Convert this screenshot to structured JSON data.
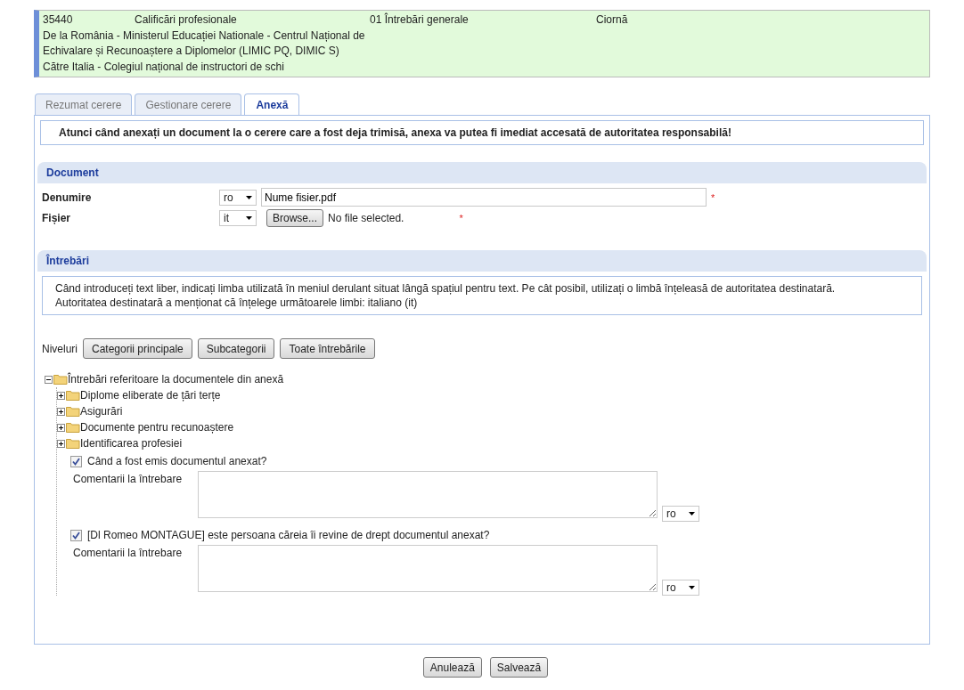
{
  "header": {
    "number": "35440",
    "category": "Calificări profesionale",
    "stage": "01 Întrebări generale",
    "status": "Ciornă",
    "from": "De la România - Ministerul Educației Nationale - Centrul Național de Echivalare și Recunoaștere a Diplomelor (LIMIC PQ, DIMIC S)",
    "to": "Către Italia - Colegiul național de instructori de schi"
  },
  "tabs": [
    {
      "label": "Rezumat cerere",
      "selected": false
    },
    {
      "label": "Gestionare cerere",
      "selected": false
    },
    {
      "label": "Anexă",
      "selected": true
    }
  ],
  "notice": "Atunci când anexați un document la o cerere care a fost deja trimisă, anexa va putea fi imediat accesată de autoritatea responsabilă!",
  "document": {
    "title": "Document",
    "fields": [
      {
        "label": "Denumire",
        "language": "ro",
        "kind": "text",
        "value": "Nume fisier.pdf",
        "required_mark": "*"
      },
      {
        "label": "Fișier",
        "language": "it",
        "kind": "file",
        "button": "Browse...",
        "value": "No file selected.",
        "required_mark": "*"
      }
    ]
  },
  "questions": {
    "title": "Întrebări",
    "info_lines": [
      "Când introduceți text liber, indicați limba utilizată în meniul derulant situat lângă spațiul pentru text. Pe cât posibil, utilizați o limbă înțeleasă de autoritatea destinatară.",
      "Autoritatea destinatară a menționat că înțelege următoarele limbi: italiano (it)"
    ],
    "levels_label": "Niveluri",
    "level_buttons": [
      "Categorii principale",
      "Subcategorii",
      "Toate întrebările"
    ],
    "tree": [
      {
        "label": "Întrebări referitoare la documentele din anexă",
        "kind": "folder",
        "expanded": true,
        "children": [
          {
            "label": "Diplome eliberate de țări terțe",
            "kind": "folder",
            "expanded": false
          },
          {
            "label": "Asigurări",
            "kind": "folder",
            "expanded": false
          },
          {
            "label": "Documente pentru recunoaștere",
            "kind": "folder",
            "expanded": false
          },
          {
            "label": "Identificarea profesiei",
            "kind": "folder",
            "expanded": false
          },
          {
            "label": "Când a fost emis documentul anexat?",
            "kind": "question",
            "checked": true,
            "comment_label": "Comentarii la întrebare",
            "language": "ro"
          },
          {
            "label": "[Dl Romeo MONTAGUE] este persoana căreia îi revine de drept documentul anexat?",
            "kind": "question",
            "checked": true,
            "comment_label": "Comentarii la întrebare",
            "language": "ro"
          }
        ]
      }
    ]
  },
  "buttons": [
    "Anulează",
    "Salvează"
  ]
}
